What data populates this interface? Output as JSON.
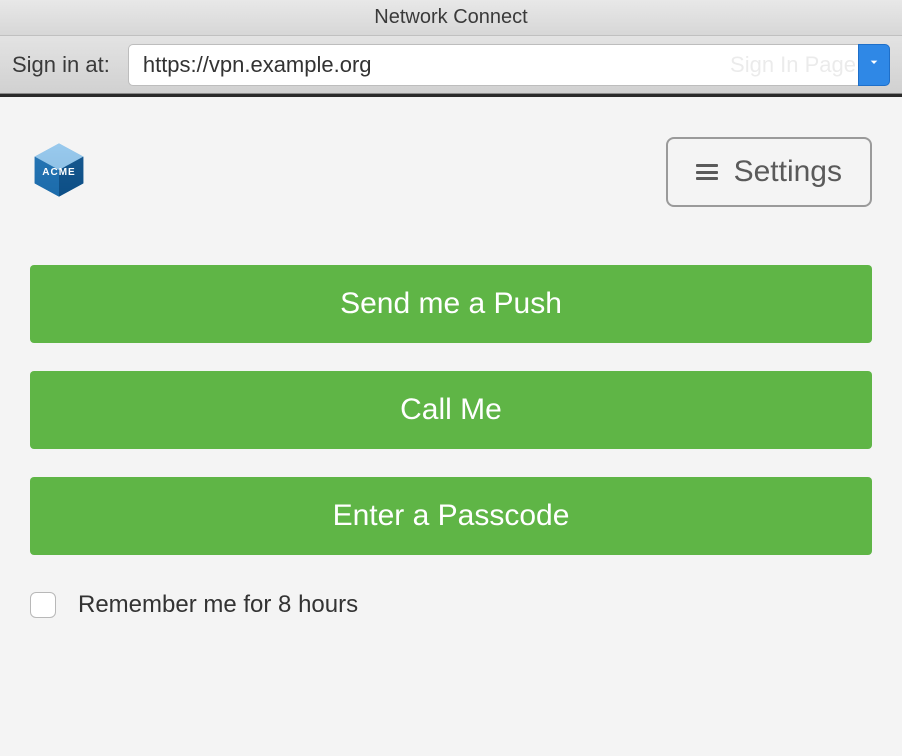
{
  "window": {
    "title": "Network Connect"
  },
  "toolbar": {
    "signin_label": "Sign in at:",
    "url_value": "https://vpn.example.org",
    "ghost_button": "Sign In Page"
  },
  "header": {
    "brand": "ACME",
    "settings_label": "Settings"
  },
  "actions": {
    "push": "Send me a Push",
    "call": "Call Me",
    "passcode": "Enter a Passcode"
  },
  "remember": {
    "label": "Remember me for 8 hours",
    "checked": false
  },
  "colors": {
    "accent_green": "#5fb546",
    "dropdown_blue": "#2f88e6"
  }
}
